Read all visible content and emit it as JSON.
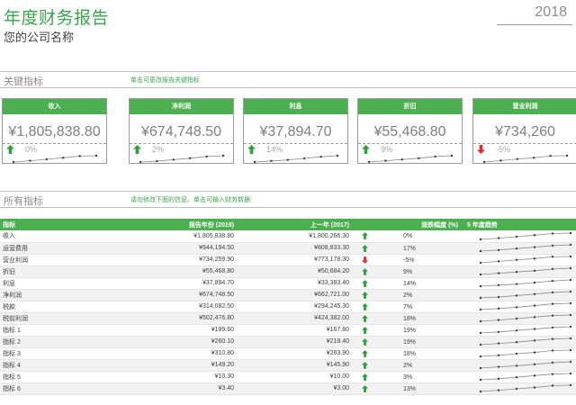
{
  "header": {
    "title": "年度财务报告",
    "company": "您的公司名称",
    "year": "2018"
  },
  "sections": {
    "key": {
      "title": "关键指标",
      "note": "单击可更改报告关键指标"
    },
    "all": {
      "title": "所有指标",
      "note": "请勿修改下面的信息。单击可输入财务数据"
    }
  },
  "colors": {
    "accent": "#4caf50",
    "up": "#2e9e3e",
    "down": "#d9302c"
  },
  "kpis": [
    {
      "label": "收入",
      "value": "¥1,805,838.80",
      "pct": "0%",
      "trend": "up",
      "spark": [
        1,
        1.6,
        2.3,
        3.0,
        3.8,
        4.0
      ]
    },
    {
      "label": "净利润",
      "value": "¥674,748.50",
      "pct": "2%",
      "trend": "up",
      "spark": [
        1,
        1.4,
        2.1,
        2.8,
        3.6,
        4.0
      ]
    },
    {
      "label": "利息",
      "value": "¥37,894.70",
      "pct": "14%",
      "trend": "up",
      "spark": [
        1,
        1.5,
        2.0,
        2.7,
        3.5,
        4.0
      ]
    },
    {
      "label": "折旧",
      "value": "¥55,468.80",
      "pct": "9%",
      "trend": "up",
      "spark": [
        1,
        1.6,
        2.2,
        2.8,
        3.6,
        4.0
      ]
    },
    {
      "label": "营业利润",
      "value": "¥734,260",
      "pct": "-5%",
      "trend": "down",
      "spark": [
        1,
        1.7,
        2.4,
        3.0,
        3.9,
        4.0
      ]
    }
  ],
  "table": {
    "headers": [
      "指标",
      "报告年份 (2018)",
      "上一年 (2017)",
      "涨跌幅度 (%)",
      "5 年度趋势"
    ],
    "rows": [
      {
        "name": "收入",
        "current": "¥1,805,838.80",
        "previous": "¥1,800,266.30",
        "trend": "up",
        "pct": "0%",
        "spark": [
          1,
          1.6,
          2.3,
          3.0,
          3.8,
          4.0
        ]
      },
      {
        "name": "运营费用",
        "current": "¥944,194.50",
        "previous": "¥808,833.30",
        "trend": "up",
        "pct": "17%",
        "spark": [
          1,
          1.5,
          2.2,
          2.9,
          3.6,
          4.0
        ]
      },
      {
        "name": "营业利润",
        "current": "¥734,259.90",
        "previous": "¥773,178.30",
        "trend": "down",
        "pct": "-5%",
        "spark": [
          1,
          1.7,
          2.4,
          3.0,
          3.9,
          4.0
        ]
      },
      {
        "name": "折旧",
        "current": "¥55,468.80",
        "previous": "¥50,684.20",
        "trend": "up",
        "pct": "9%",
        "spark": [
          1,
          1.6,
          2.2,
          2.8,
          3.6,
          4.0
        ]
      },
      {
        "name": "利息",
        "current": "¥37,894.70",
        "previous": "¥33,383.40",
        "trend": "up",
        "pct": "14%",
        "spark": [
          1,
          1.5,
          2.0,
          2.7,
          3.5,
          4.0
        ]
      },
      {
        "name": "净利润",
        "current": "¥674,748.50",
        "previous": "¥662,721.00",
        "trend": "up",
        "pct": "2%",
        "spark": [
          1,
          1.4,
          2.1,
          2.8,
          3.6,
          4.0
        ]
      },
      {
        "name": "税款",
        "current": "¥314,082.50",
        "previous": "¥294,245.30",
        "trend": "up",
        "pct": "7%",
        "spark": [
          1,
          1.5,
          2.1,
          2.9,
          3.7,
          4.0
        ]
      },
      {
        "name": "税前利润",
        "current": "¥502,476.80",
        "previous": "¥424,382.00",
        "trend": "up",
        "pct": "18%",
        "spark": [
          1,
          1.6,
          2.3,
          3.0,
          3.7,
          4.0
        ]
      },
      {
        "name": "指标 1",
        "current": "¥199.60",
        "previous": "¥167.80",
        "trend": "up",
        "pct": "19%",
        "spark": [
          1,
          1.5,
          2.2,
          2.9,
          3.6,
          4.0
        ]
      },
      {
        "name": "指标 2",
        "current": "¥260.10",
        "previous": "¥218.40",
        "trend": "up",
        "pct": "19%",
        "spark": [
          1,
          1.6,
          2.2,
          3.0,
          3.7,
          4.0
        ]
      },
      {
        "name": "指标 3",
        "current": "¥310.80",
        "previous": "¥263.90",
        "trend": "up",
        "pct": "18%",
        "spark": [
          1,
          1.5,
          2.3,
          2.9,
          3.8,
          4.0
        ]
      },
      {
        "name": "指标 4",
        "current": "¥149.20",
        "previous": "¥145.90",
        "trend": "up",
        "pct": "2%",
        "spark": [
          1,
          1.6,
          2.1,
          2.8,
          3.6,
          4.0
        ]
      },
      {
        "name": "指标 5",
        "current": "¥10.30",
        "previous": "¥10.00",
        "trend": "up",
        "pct": "3%",
        "spark": [
          1,
          1.5,
          2.2,
          3.0,
          3.7,
          4.0
        ]
      },
      {
        "name": "指标 6",
        "current": "¥3.40",
        "previous": "¥3.00",
        "trend": "up",
        "pct": "13%",
        "spark": [
          1,
          1.6,
          2.3,
          2.9,
          3.8,
          4.0
        ]
      }
    ]
  }
}
